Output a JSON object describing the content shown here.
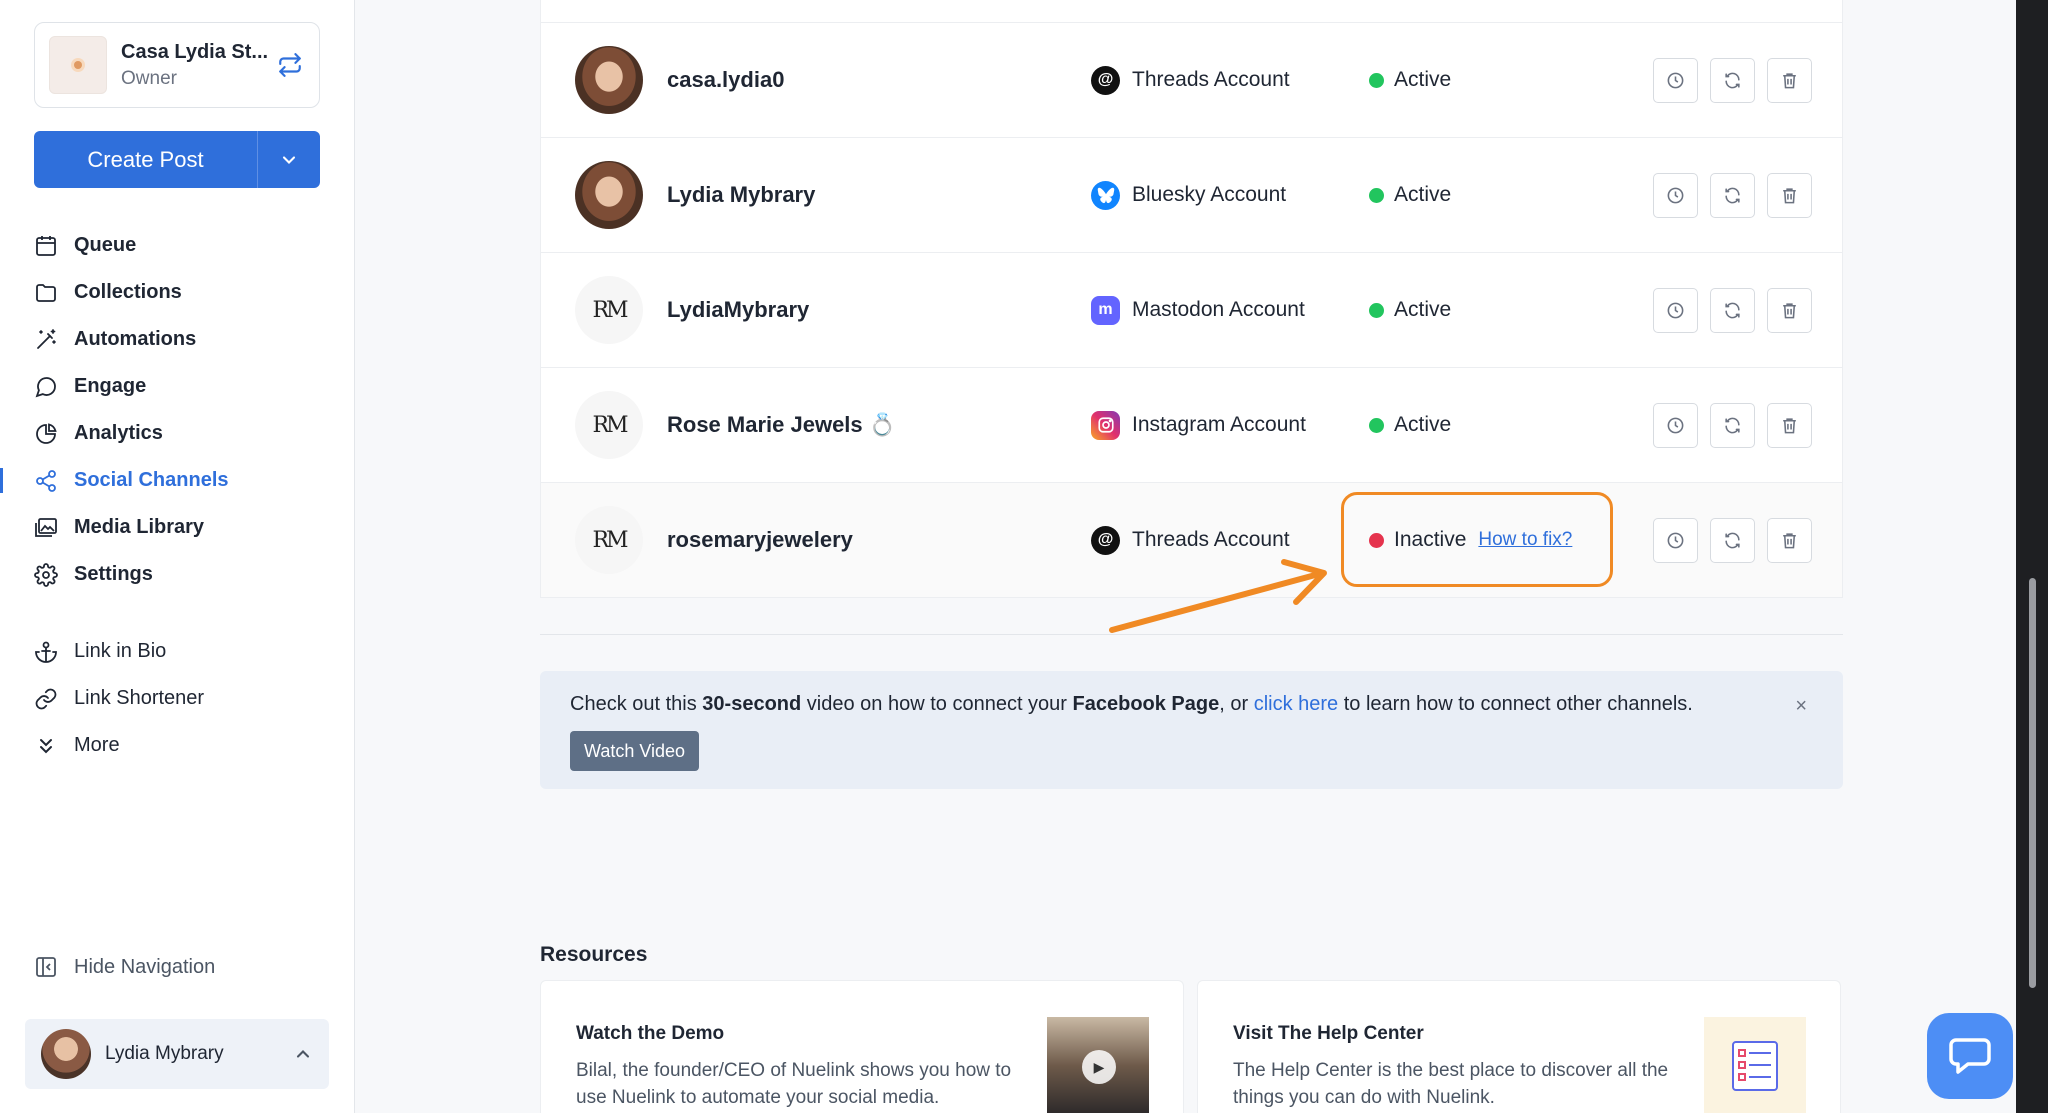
{
  "workspace": {
    "name": "Casa Lydia St...",
    "role": "Owner"
  },
  "create_post": {
    "label": "Create Post"
  },
  "nav": {
    "items": [
      {
        "label": "Queue",
        "icon": "calendar-icon"
      },
      {
        "label": "Collections",
        "icon": "folder-icon"
      },
      {
        "label": "Automations",
        "icon": "magic-wand-icon"
      },
      {
        "label": "Engage",
        "icon": "chat-bubble-icon"
      },
      {
        "label": "Analytics",
        "icon": "pie-chart-icon"
      },
      {
        "label": "Social Channels",
        "icon": "share-icon",
        "active": true
      },
      {
        "label": "Media Library",
        "icon": "images-icon"
      },
      {
        "label": "Settings",
        "icon": "gear-icon"
      }
    ],
    "secondary": [
      {
        "label": "Link in Bio",
        "icon": "anchor-icon"
      },
      {
        "label": "Link Shortener",
        "icon": "link-icon"
      },
      {
        "label": "More",
        "icon": "chevrons-down-icon"
      }
    ],
    "hide_label": "Hide Navigation"
  },
  "user": {
    "name": "Lydia Mybrary"
  },
  "accounts": [
    {
      "name": "casa.lydia0",
      "type": "Threads Account",
      "status": "Active",
      "platform": "threads",
      "avatar": "photo"
    },
    {
      "name": "Lydia Mybrary",
      "type": "Bluesky Account",
      "status": "Active",
      "platform": "bluesky",
      "avatar": "photo"
    },
    {
      "name": "LydiaMybrary",
      "type": "Mastodon Account",
      "status": "Active",
      "platform": "mastodon",
      "avatar": "monogram"
    },
    {
      "name": "Rose Marie Jewels 💍",
      "type": "Instagram Account",
      "status": "Active",
      "platform": "instagram",
      "avatar": "monogram"
    },
    {
      "name": "rosemaryjewelery",
      "type": "Threads Account",
      "status": "Inactive",
      "platform": "threads",
      "avatar": "monogram",
      "fix_link": "How to fix?"
    }
  ],
  "colors": {
    "accent": "#2f6fdb",
    "active": "#22c55e",
    "inactive": "#e5334d",
    "highlight": "#f08a24"
  },
  "banner": {
    "t1": "Check out this ",
    "b1": "30-second",
    "t2": " video on how to connect your ",
    "b2": "Facebook Page",
    "t3": ", or ",
    "link": "click here",
    "t4": " to learn how to connect other channels.",
    "close": "×",
    "button": "Watch Video"
  },
  "resources": {
    "title": "Resources",
    "cards": [
      {
        "title": "Watch the Demo",
        "text": "Bilal, the founder/CEO of Nuelink shows you how to use Nuelink to automate your social media."
      },
      {
        "title": "Visit The Help Center",
        "text": "The Help Center is the best place to discover all the things you can do with Nuelink."
      }
    ]
  }
}
